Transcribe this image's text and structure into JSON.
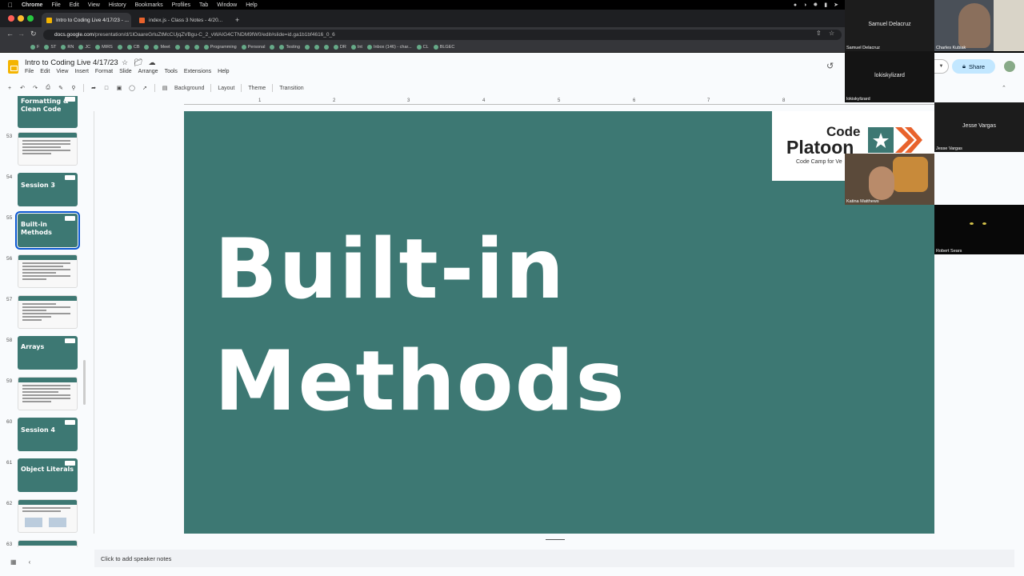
{
  "menubar": {
    "app": "Chrome",
    "items": [
      "File",
      "Edit",
      "View",
      "History",
      "Bookmarks",
      "Profiles",
      "Tab",
      "Window",
      "Help"
    ]
  },
  "tabs": [
    {
      "label": "Intro to Coding Live 4/17/23 - ..."
    },
    {
      "label": "index.js - Class 3 Notes - 4/20..."
    }
  ],
  "address": {
    "host": "docs.google.com",
    "path": "/presentation/d/1lOaareGrluZtMcCUjqZVBgu-C_2_vWAIG4CTNDM9fW0/edit#slide=id.ga1b1bf4616_0_6"
  },
  "bookmarks": [
    "F",
    "ST",
    "RN",
    "JC",
    "MIRS",
    "CB",
    "Meet",
    "Programming",
    "Personal",
    "Testing",
    "DR",
    "Int",
    "Inbox (146) - char...",
    "CL",
    "BLGEC"
  ],
  "doc": {
    "title": "Intro to Coding Live 4/17/23",
    "menus": [
      "File",
      "Edit",
      "View",
      "Insert",
      "Format",
      "Slide",
      "Arrange",
      "Tools",
      "Extensions",
      "Help"
    ],
    "toolbar_text": [
      "Background",
      "Layout",
      "Theme",
      "Transition"
    ],
    "share_label": "Share",
    "notes_placeholder": "Click to add speaker notes"
  },
  "ruler_labels": [
    "1",
    "2",
    "3",
    "4",
    "5",
    "6",
    "7",
    "8"
  ],
  "filmstrip": [
    {
      "num": "",
      "title": "Formatting & Clean Code",
      "type": "title"
    },
    {
      "num": "53",
      "title": "",
      "type": "content"
    },
    {
      "num": "54",
      "title": "Session 3",
      "type": "title"
    },
    {
      "num": "55",
      "title": "Built-in Methods",
      "type": "title",
      "selected": true
    },
    {
      "num": "56",
      "title": "",
      "type": "content"
    },
    {
      "num": "57",
      "title": "",
      "type": "content"
    },
    {
      "num": "58",
      "title": "Arrays",
      "type": "title"
    },
    {
      "num": "59",
      "title": "",
      "type": "content"
    },
    {
      "num": "60",
      "title": "Session 4",
      "type": "title"
    },
    {
      "num": "61",
      "title": "Object Literals",
      "type": "title"
    },
    {
      "num": "62",
      "title": "",
      "type": "content"
    },
    {
      "num": "63",
      "title": "",
      "type": "content"
    }
  ],
  "slide": {
    "line1": "Built-in",
    "line2": "Methods",
    "logo_code": "Code",
    "logo_platoon": "Platoon",
    "logo_tagline": "Code Camp for Ve"
  },
  "participants": [
    {
      "name": "Samuel Delacruz",
      "label": "Samuel Delacruz"
    },
    {
      "name": "Charles Kubiak"
    },
    {
      "name": "lokiskylizard",
      "label": "lokiskylizard"
    },
    {
      "name": "Jesse Vargas",
      "label": "Jesse Vargas"
    },
    {
      "name": "Katina Matthews"
    },
    {
      "name": "Robert Sears"
    }
  ],
  "colors": {
    "slide_bg": "#3d7873",
    "share_bg": "#c2e7ff",
    "accent_orange": "#e8622c"
  }
}
